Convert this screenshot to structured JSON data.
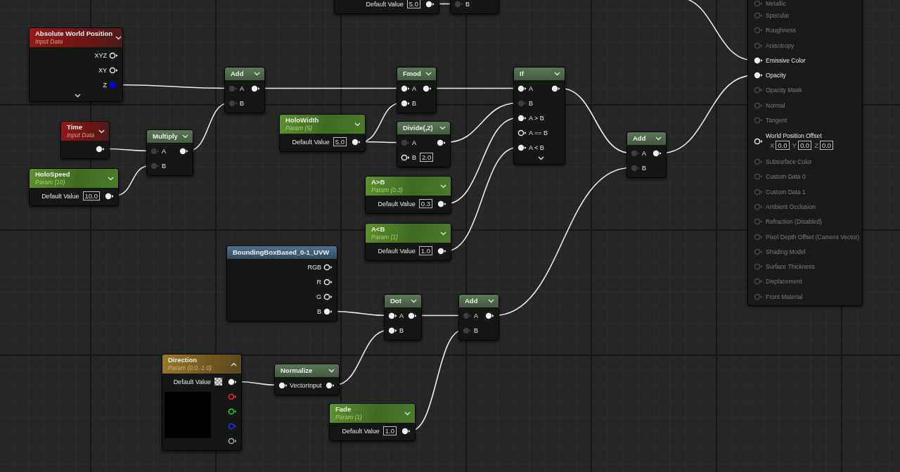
{
  "nodes": [
    {
      "title": "Absolute World Position",
      "subtitle": "Input Data",
      "kind": "input",
      "expanded": false,
      "more_pins": true,
      "rows": [
        {
          "output": {
            "label": "XYZ",
            "kind": "hollow"
          }
        },
        {
          "output": {
            "label": "XY",
            "kind": "hollow"
          }
        },
        {
          "output": {
            "label": "Z",
            "kind": "filled",
            "color": "#0000ff"
          }
        }
      ]
    },
    {
      "title": "Time",
      "subtitle": "Input Data",
      "kind": "input",
      "expanded": false,
      "rows": [
        {
          "output": {
            "kind": "filled"
          }
        }
      ]
    },
    {
      "title": "HoloSpeed",
      "subtitle": "Param (10)",
      "kind": "param",
      "expanded": false,
      "rows": [
        {
          "output": {
            "label": "Default Value",
            "value": "10.0",
            "kind": "filled"
          }
        }
      ]
    },
    {
      "title": "Multiply",
      "kind": "math",
      "expanded": false,
      "rows": [
        {
          "input": {
            "label": "A",
            "kind": "dim"
          },
          "output": {
            "kind": "filled"
          }
        },
        {
          "input": {
            "label": "B",
            "kind": "dim"
          }
        }
      ]
    },
    {
      "title": "Add",
      "kind": "math",
      "expanded": false,
      "rows": [
        {
          "input": {
            "label": "A",
            "kind": "dim"
          },
          "output": {
            "kind": "filled"
          }
        },
        {
          "input": {
            "label": "B",
            "kind": "dim"
          }
        }
      ]
    },
    {
      "title": "HoloWidth",
      "subtitle": "Param (5)",
      "kind": "param",
      "expanded": false,
      "rows": [
        {
          "output": {
            "label": "Default Value",
            "value": "5.0",
            "kind": "filled"
          }
        }
      ]
    },
    {
      "title": "Fmod",
      "kind": "math",
      "expanded": false,
      "rows": [
        {
          "input": {
            "label": "A",
            "kind": "filled"
          },
          "output": {
            "kind": "filled"
          }
        },
        {
          "input": {
            "label": "B",
            "kind": "filled"
          }
        }
      ]
    },
    {
      "title": "Divide(,2)",
      "kind": "math",
      "expanded": false,
      "rows": [
        {
          "input": {
            "label": "A",
            "kind": "dim"
          },
          "output": {
            "kind": "filled"
          }
        },
        {
          "input": {
            "label": "B",
            "kind": "hollow",
            "value": "2.0"
          }
        }
      ]
    },
    {
      "title": "If",
      "kind": "math",
      "expanded": false,
      "more_pins": true,
      "rows": [
        {
          "input": {
            "label": "A",
            "kind": "filled"
          },
          "output": {
            "kind": "filled"
          }
        },
        {
          "input": {
            "label": "B",
            "kind": "dim"
          }
        },
        {
          "input": {
            "label": "A > B",
            "kind": "filled"
          }
        },
        {
          "input": {
            "label": "A == B",
            "kind": "hollow"
          }
        },
        {
          "input": {
            "label": "A < B",
            "kind": "filled"
          }
        }
      ]
    },
    {
      "title": "A>B",
      "subtitle": "Param (0.3)",
      "kind": "param",
      "expanded": false,
      "rows": [
        {
          "output": {
            "label": "Default Value",
            "value": "0.3",
            "kind": "filled"
          }
        }
      ]
    },
    {
      "title": "A<B",
      "subtitle": "Param (1)",
      "kind": "param",
      "expanded": false,
      "rows": [
        {
          "output": {
            "label": "Default Value",
            "value": "1.0",
            "kind": "filled"
          }
        }
      ]
    },
    {
      "title": "Add",
      "kind": "math",
      "expanded": false,
      "rows": [
        {
          "input": {
            "label": "A",
            "kind": "dim"
          },
          "output": {
            "kind": "filled"
          }
        },
        {
          "input": {
            "label": "B",
            "kind": "dim"
          }
        }
      ]
    },
    {
      "title": "BoundingBoxBased_0-1_UVW",
      "kind": "function",
      "rows": [
        {
          "output": {
            "label": "RGB",
            "kind": "hollow"
          }
        },
        {
          "output": {
            "label": "R",
            "kind": "hollow"
          }
        },
        {
          "output": {
            "label": "G",
            "kind": "hollow"
          }
        },
        {
          "output": {
            "label": "B",
            "kind": "filled"
          }
        }
      ]
    },
    {
      "title": "Dot",
      "kind": "math",
      "expanded": false,
      "rows": [
        {
          "input": {
            "label": "A",
            "kind": "filled"
          },
          "output": {
            "kind": "filled"
          }
        },
        {
          "input": {
            "label": "B",
            "kind": "filled"
          }
        }
      ]
    },
    {
      "title": "Add",
      "kind": "math",
      "expanded": false,
      "rows": [
        {
          "input": {
            "label": "A",
            "kind": "dim"
          },
          "output": {
            "kind": "filled"
          }
        },
        {
          "input": {
            "label": "B",
            "kind": "dim"
          }
        }
      ]
    },
    {
      "title": "Direction",
      "subtitle": "Param (0.0,-1.0)",
      "kind": "vector",
      "expanded": true,
      "rows": [
        {
          "output": {
            "label": "Default Value",
            "swatch": true,
            "kind": "filled"
          }
        },
        {
          "output": {
            "kind": "hollow",
            "color": "#ff2a2a"
          }
        },
        {
          "output": {
            "kind": "hollow",
            "color": "#22e022"
          }
        },
        {
          "output": {
            "kind": "hollow",
            "color": "#2a2aff"
          }
        },
        {
          "output": {
            "kind": "hollow",
            "color": "#b0b0b0"
          }
        }
      ]
    },
    {
      "title": "Normalize",
      "kind": "math",
      "expanded": false,
      "rows": [
        {
          "input": {
            "label": "VectorInput",
            "kind": "filled"
          },
          "output": {
            "kind": "filled"
          }
        }
      ]
    },
    {
      "title": "Fade",
      "subtitle": "Param (1)",
      "kind": "param",
      "expanded": false,
      "rows": [
        {
          "output": {
            "label": "Default Value",
            "value": "1.0",
            "kind": "filled"
          }
        }
      ]
    },
    {
      "rows": [
        {
          "output": {
            "label": "Default Value",
            "value": "5.0",
            "kind": "filled"
          }
        }
      ]
    },
    {
      "rows": [
        {
          "input": {
            "label": "B",
            "kind": "dim"
          }
        }
      ]
    }
  ],
  "result_node": {
    "items": [
      {
        "label": "Metallic",
        "active": false
      },
      {
        "label": "Specular",
        "active": false
      },
      {
        "label": "Roughness",
        "active": false
      },
      {
        "label": "Anisotropy",
        "active": false
      },
      {
        "label": "Emissive Color",
        "active": true
      },
      {
        "label": "Opacity",
        "active": true
      },
      {
        "label": "Opacity Mask",
        "active": false
      },
      {
        "label": "Normal",
        "active": false
      },
      {
        "label": "Tangent",
        "active": false
      },
      {
        "label": "World Position Offset",
        "active": true,
        "fields": [
          {
            "label": "X",
            "value": "0.0"
          },
          {
            "label": "Y",
            "value": "0.0"
          },
          {
            "label": "Z",
            "value": "0.0"
          }
        ]
      },
      {
        "label": "Subsurface Color",
        "active": false
      },
      {
        "label": "Custom Data 0",
        "active": false
      },
      {
        "label": "Custom Data 1",
        "active": false
      },
      {
        "label": "Ambient Occlusion",
        "active": false
      },
      {
        "label": "Refraction (Disabled)",
        "active": false
      },
      {
        "label": "Pixel Depth Offset (Camera Vector)",
        "active": false
      },
      {
        "label": "Shading Model",
        "active": false
      },
      {
        "label": "Surface Thickness",
        "active": false
      },
      {
        "label": "Displacement",
        "active": false
      },
      {
        "label": "Front Material",
        "active": false
      }
    ]
  }
}
